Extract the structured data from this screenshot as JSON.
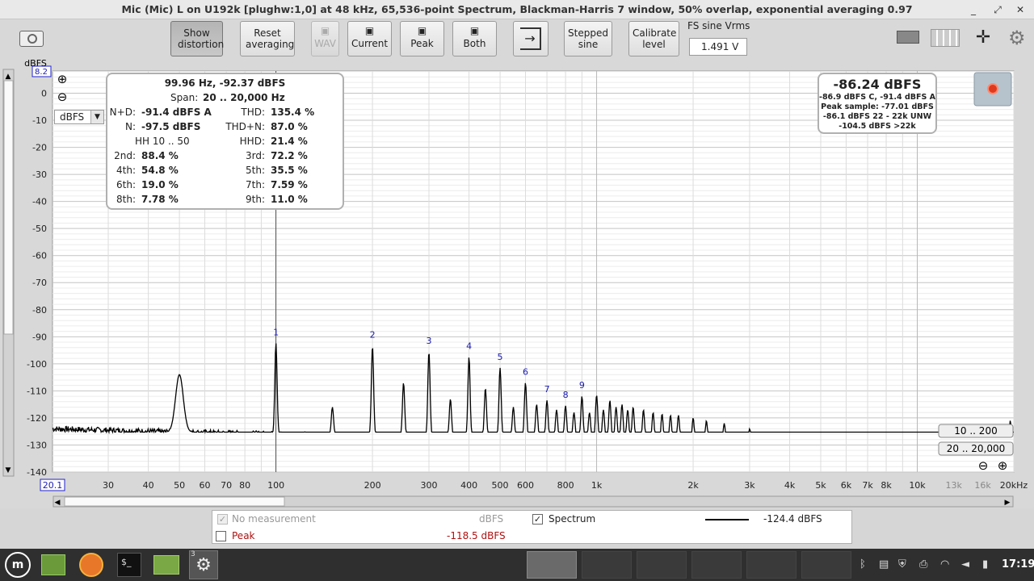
{
  "window": {
    "title": "Mic (Mic) L on U192k [plughw:1,0] at 48 kHz, 65,536-point Spectrum, Blackman-Harris 7 window, 50% overlap, exponential averaging 0.97",
    "controls": [
      "minimize-icon",
      "restore-icon",
      "close-icon"
    ]
  },
  "toolbar": {
    "show_distortion": "Show distortion",
    "reset_averaging": "Reset averaging",
    "wav": "WAV",
    "current": "Current",
    "peak": "Peak",
    "both": "Both",
    "stepped_sine": "Stepped sine",
    "calibrate_level": "Calibrate level",
    "fs_label": "FS sine Vrms",
    "fs_value": "1.491 V"
  },
  "axis": {
    "y_unit": "dBFS",
    "y_max_box": "8.2",
    "x_min_box": "20.1",
    "unit_select": "dBFS",
    "x_range_1": "10 .. 200",
    "x_range_2": "20 .. 20,000"
  },
  "readout": {
    "cursor": "99.96 Hz, -92.37 dBFS",
    "span_label": "Span:",
    "span_value": "20 .. 20,000 Hz",
    "rows": [
      {
        "l_label": "N+D:",
        "l_value": "-91.4 dBFS A",
        "r_label": "THD:",
        "r_value": "135.4 %"
      },
      {
        "l_label": "N:",
        "l_value": "-97.5 dBFS",
        "r_label": "THD+N:",
        "r_value": "87.0 %"
      },
      {
        "l_label": "HH 10 .. 50",
        "l_value": "",
        "r_label": "HHD:",
        "r_value": "21.4 %"
      },
      {
        "l_label": "2nd:",
        "l_value": "88.4 %",
        "r_label": "3rd:",
        "r_value": "72.2 %"
      },
      {
        "l_label": "4th:",
        "l_value": "54.8 %",
        "r_label": "5th:",
        "r_value": "35.5 %"
      },
      {
        "l_label": "6th:",
        "l_value": "19.0 %",
        "r_label": "7th:",
        "r_value": "7.59 %"
      },
      {
        "l_label": "8th:",
        "l_value": "7.78 %",
        "r_label": "9th:",
        "r_value": "11.0 %"
      }
    ]
  },
  "level": {
    "main": "-86.24 dBFS",
    "lines": [
      "-86.9 dBFS C, -91.4 dBFS A",
      "Peak sample: -77.01 dBFS",
      "-86.1 dBFS 22 - 22k UNW",
      "-104.5 dBFS >22k"
    ]
  },
  "legend": {
    "no_measurement": "No measurement",
    "no_measurement_unit": "dBFS",
    "spectrum": "Spectrum",
    "spectrum_value": "-124.4 dBFS",
    "peak": "Peak",
    "peak_value": "-118.5 dBFS"
  },
  "taskbar": {
    "clock": "17:19",
    "badge": "3"
  },
  "chart_data": {
    "type": "line",
    "title": "",
    "xlabel": "",
    "ylabel": "dBFS",
    "x_scale": "log",
    "xlim": [
      20.1,
      20000
    ],
    "ylim": [
      -140,
      8.2
    ],
    "grid": true,
    "y_ticks": [
      0,
      -10,
      -20,
      -30,
      -40,
      -50,
      -60,
      -70,
      -80,
      -90,
      -100,
      -110,
      -120,
      -130,
      -140
    ],
    "x_tick_labels": [
      {
        "x": 30,
        "label": "30"
      },
      {
        "x": 40,
        "label": "40"
      },
      {
        "x": 50,
        "label": "50"
      },
      {
        "x": 60,
        "label": "60"
      },
      {
        "x": 70,
        "label": "70"
      },
      {
        "x": 80,
        "label": "80"
      },
      {
        "x": 100,
        "label": "100"
      },
      {
        "x": 200,
        "label": "200"
      },
      {
        "x": 300,
        "label": "300"
      },
      {
        "x": 400,
        "label": "400"
      },
      {
        "x": 500,
        "label": "500"
      },
      {
        "x": 600,
        "label": "600"
      },
      {
        "x": 800,
        "label": "800"
      },
      {
        "x": 1000,
        "label": "1k"
      },
      {
        "x": 2000,
        "label": "2k"
      },
      {
        "x": 3000,
        "label": "3k"
      },
      {
        "x": 4000,
        "label": "4k"
      },
      {
        "x": 5000,
        "label": "5k"
      },
      {
        "x": 6000,
        "label": "6k"
      },
      {
        "x": 7000,
        "label": "7k"
      },
      {
        "x": 8000,
        "label": "8k"
      },
      {
        "x": 10000,
        "label": "10k"
      },
      {
        "x": 13000,
        "label": "13k"
      },
      {
        "x": 16000,
        "label": "16k"
      },
      {
        "x": 20000,
        "label": "20kHz"
      }
    ],
    "cursor_x": 99.96,
    "series": [
      {
        "name": "Spectrum",
        "noise_floor": [
          [
            20.1,
            -124
          ],
          [
            40,
            -125
          ],
          [
            100,
            -126
          ],
          [
            300,
            -127
          ],
          [
            1000,
            -128
          ],
          [
            3000,
            -131
          ],
          [
            10000,
            -134
          ],
          [
            20000,
            -134
          ]
        ],
        "peaks": [
          [
            50,
            -104
          ],
          [
            100,
            -92.4
          ],
          [
            150,
            -116
          ],
          [
            200,
            -93.4
          ],
          [
            250,
            -107
          ],
          [
            300,
            -95.5
          ],
          [
            350,
            -113
          ],
          [
            400,
            -97.5
          ],
          [
            450,
            -109
          ],
          [
            500,
            -101.5
          ],
          [
            550,
            -116
          ],
          [
            600,
            -107
          ],
          [
            650,
            -115
          ],
          [
            700,
            -113.5
          ],
          [
            750,
            -117
          ],
          [
            800,
            -115.5
          ],
          [
            850,
            -118
          ],
          [
            900,
            -112
          ],
          [
            950,
            -118
          ],
          [
            1000,
            -111.5
          ],
          [
            1050,
            -117
          ],
          [
            1100,
            -113.5
          ],
          [
            1150,
            -116
          ],
          [
            1200,
            -115
          ],
          [
            1250,
            -117
          ],
          [
            1300,
            -116
          ],
          [
            1400,
            -117
          ],
          [
            1500,
            -118
          ],
          [
            1600,
            -118.5
          ],
          [
            1700,
            -119
          ],
          [
            1800,
            -119
          ],
          [
            2000,
            -120
          ],
          [
            2200,
            -121
          ],
          [
            2500,
            -122
          ],
          [
            3000,
            -124
          ],
          [
            3500,
            -126
          ],
          [
            4000,
            -128
          ],
          [
            5000,
            -130
          ],
          [
            6000,
            -131
          ],
          [
            8000,
            -132
          ],
          [
            10000,
            -133
          ],
          [
            19500,
            -121
          ]
        ]
      }
    ],
    "harmonic_markers": [
      {
        "label": "1",
        "x": 100,
        "y": -92.4
      },
      {
        "label": "2",
        "x": 200,
        "y": -93.4
      },
      {
        "label": "3",
        "x": 300,
        "y": -95.5
      },
      {
        "label": "4",
        "x": 400,
        "y": -97.5
      },
      {
        "label": "5",
        "x": 500,
        "y": -101.5
      },
      {
        "label": "6",
        "x": 600,
        "y": -107
      },
      {
        "label": "7",
        "x": 700,
        "y": -113.5
      },
      {
        "label": "8",
        "x": 800,
        "y": -115.5
      },
      {
        "label": "9",
        "x": 900,
        "y": -112
      }
    ]
  }
}
